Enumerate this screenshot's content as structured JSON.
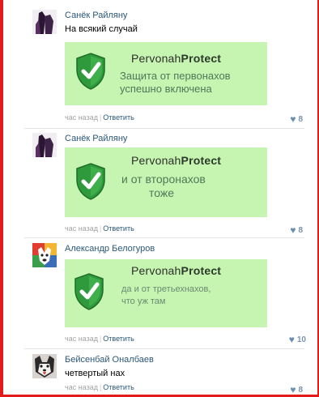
{
  "comments": [
    {
      "author": "Санёк Райляну",
      "text": "На всякий случай",
      "brand_regular": "Pervonah",
      "brand_bold": "Protect",
      "card_line1": "Защита от первонахов",
      "card_line2": "успешно включена",
      "time": "час назад",
      "reply": "Ответить",
      "likes": "8"
    },
    {
      "author": "Санёк Райляну",
      "text": "",
      "brand_regular": "Pervonah",
      "brand_bold": "Protect",
      "card_line1": "и от второнахов",
      "card_line2": "тоже",
      "time": "час назад",
      "reply": "Ответить",
      "likes": "8"
    },
    {
      "author": "Александр Белогуров",
      "text": "",
      "brand_regular": "Pervonah",
      "brand_bold": "Protect",
      "card_line1": "да и от третьехнахов,",
      "card_line2": "что уж там",
      "time": "час назад",
      "reply": "Ответить",
      "likes": "10"
    },
    {
      "author": "Бейсенбай Оналбаев",
      "text": "четвертый нах",
      "time": "час назад",
      "reply": "Ответить",
      "likes": "8"
    }
  ],
  "colors": {
    "author_link": "#2b587a",
    "card_background": "#c6f5b1",
    "shield_green": "#2e9a3b",
    "frame_red": "#e31b1b"
  },
  "icons": [
    "shield-check-icon",
    "heart-icon"
  ]
}
